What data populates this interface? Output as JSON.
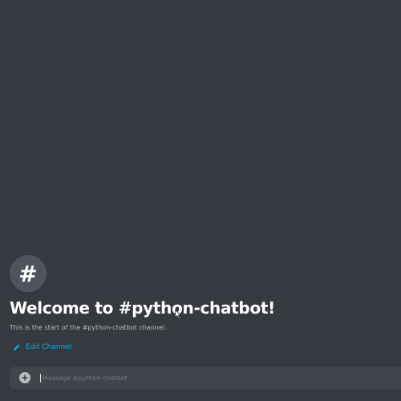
{
  "channel": {
    "hash_symbol": "#",
    "welcome_title": "Welcome to #python-chatbot!",
    "welcome_subtitle": "This is the start of the #python-chatbot channel.",
    "edit_label": "Edit Channel"
  },
  "composer": {
    "placeholder": "Message #python-chatbot",
    "value": "",
    "plus_icon": "plus-circle-icon"
  },
  "colors": {
    "background": "#36393f",
    "accent_link": "#00aff4",
    "input_bg": "#40444b"
  }
}
